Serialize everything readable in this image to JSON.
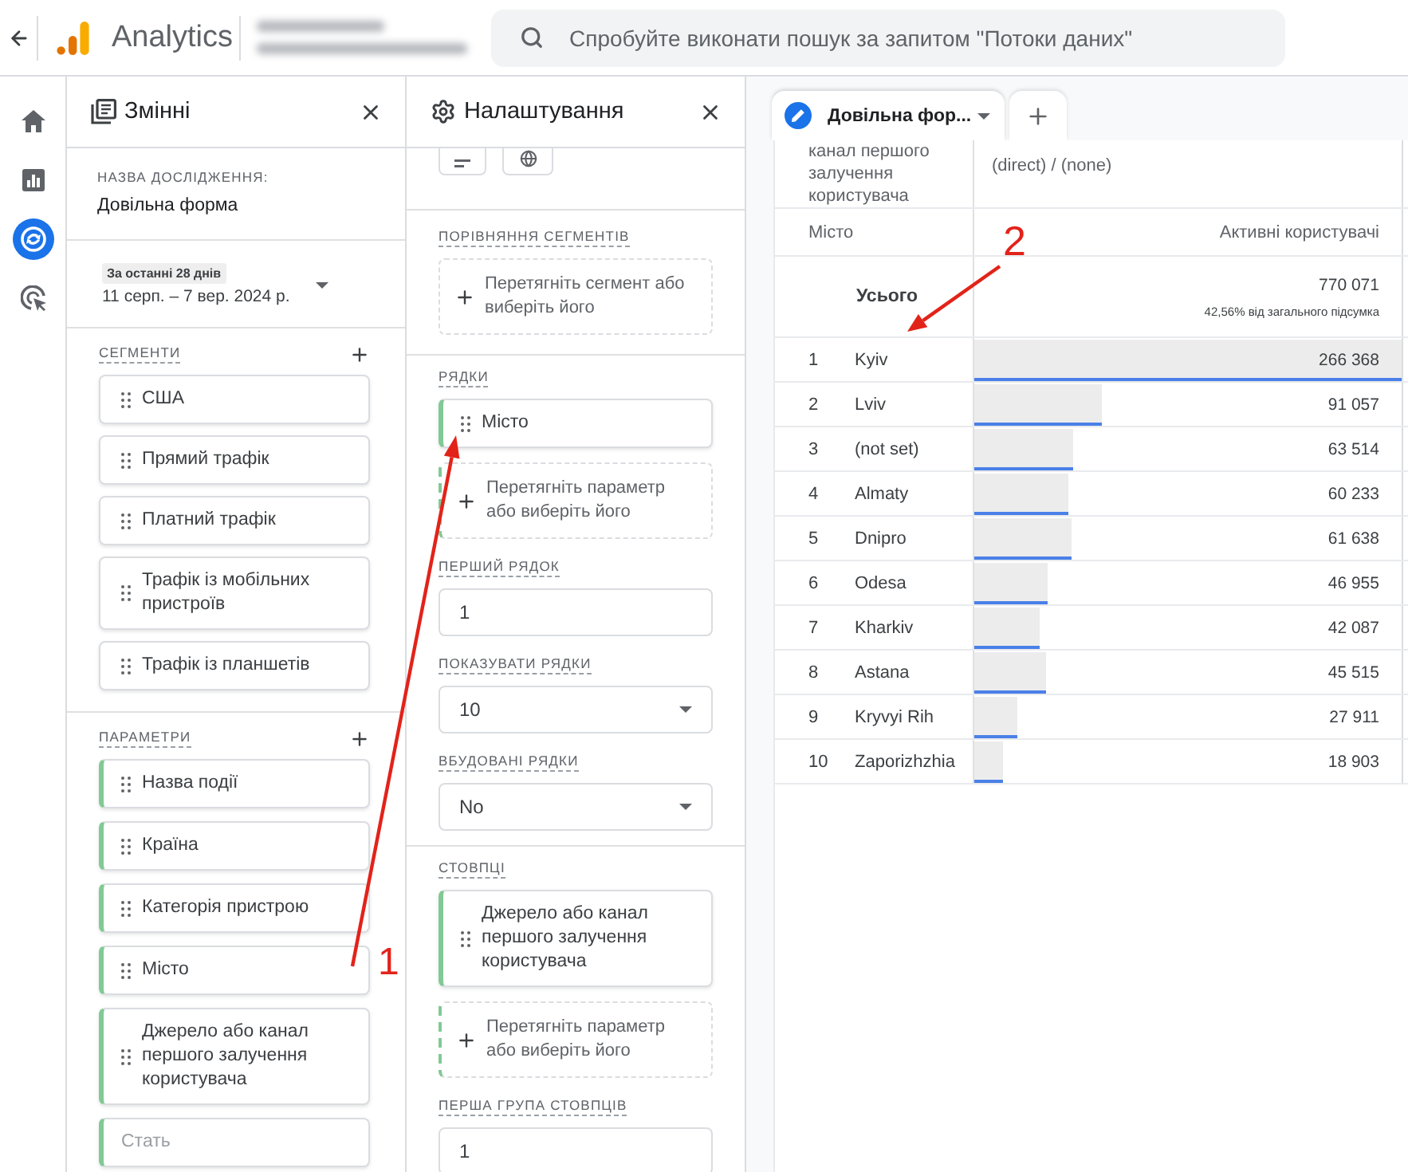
{
  "top_bar": {
    "product_name": "Analytics",
    "search": {
      "placeholder": "Спробуйте виконати пошук за запитом \"Потоки даних\""
    }
  },
  "nav_rail": {
    "items": [
      {
        "selected": false
      },
      {
        "selected": false
      },
      {
        "selected": true
      },
      {
        "selected": false
      }
    ]
  },
  "variables_panel": {
    "title": "Змінні",
    "exploration_name": {
      "label": "НАЗВА ДОСЛІДЖЕННЯ:",
      "value": "Довільна форма"
    },
    "date_range": {
      "preset": "За останні 28 днів",
      "range": "11 серп. – 7 вер. 2024 р."
    },
    "segments": {
      "label": "СЕГМЕНТИ",
      "items": [
        "США",
        "Прямий трафік",
        "Платний трафік",
        "Трафік із мобільних пристроїв",
        "Трафік із планшетів"
      ]
    },
    "dimensions": {
      "label": "ПАРАМЕТРИ",
      "items": [
        {
          "name": "Назва події",
          "disabled": false
        },
        {
          "name": "Країна",
          "disabled": false
        },
        {
          "name": "Категорія пристрою",
          "disabled": false
        },
        {
          "name": "Місто",
          "disabled": false
        },
        {
          "name": "Джерело або канал першого залучення користувача",
          "disabled": false
        },
        {
          "name": "Стать",
          "disabled": true
        }
      ]
    }
  },
  "settings_panel": {
    "title": "Налаштування",
    "segment_comparison": {
      "label": "ПОРІВНЯННЯ СЕГМЕНТІВ",
      "drop_hint": "Перетягніть сегмент або виберіть його"
    },
    "rows": {
      "label": "РЯДКИ",
      "items": [
        "Місто"
      ],
      "drop_hint": "Перетягніть параметр або виберіть його"
    },
    "first_row": {
      "label": "ПЕРШИЙ РЯДОК",
      "value": "1"
    },
    "show_rows": {
      "label": "ПОКАЗУВАТИ РЯДКИ",
      "value": "10"
    },
    "nested_rows": {
      "label": "ВБУДОВАНІ РЯДКИ",
      "value": "No"
    },
    "columns": {
      "label": "СТОВПЦІ",
      "items": [
        "Джерело або канал першого залучення користувача"
      ],
      "drop_hint": "Перетягніть параметр або виберіть його"
    },
    "first_column_group": {
      "label": "ПЕРША ГРУПА СТОВПЦІВ",
      "value": "1"
    }
  },
  "report": {
    "tabs": [
      {
        "label": "Довільна фор...",
        "selected": true
      }
    ],
    "table": {
      "column_dimension": "канал першого залучення користувача",
      "column_value": "(direct) / (none)",
      "row_dimension": "Місто",
      "metric": "Активні користувачі",
      "total": {
        "label": "Усього",
        "value": "770 071",
        "share": "42,56% від загального підсумка"
      },
      "rows": [
        {
          "rank": "1",
          "city": "Kyiv",
          "value": "266 368",
          "level": 1
        },
        {
          "rank": "2",
          "city": "Lviv",
          "value": "91 057",
          "level": 0.3
        },
        {
          "rank": "3",
          "city": "(not set)",
          "value": "63 514",
          "level": 0.23
        },
        {
          "rank": "4",
          "city": "Almaty",
          "value": "60 233",
          "level": 0.22
        },
        {
          "rank": "5",
          "city": "Dnipro",
          "value": "61 638",
          "level": 0.226
        },
        {
          "rank": "6",
          "city": "Odesa",
          "value": "46 955",
          "level": 0.17
        },
        {
          "rank": "7",
          "city": "Kharkiv",
          "value": "42 087",
          "level": 0.153
        },
        {
          "rank": "8",
          "city": "Astana",
          "value": "45 515",
          "level": 0.167
        },
        {
          "rank": "9",
          "city": "Kryvyi Rih",
          "value": "27 911",
          "level": 0.1
        },
        {
          "rank": "10",
          "city": "Zaporizhzhia",
          "value": "18 903",
          "level": 0.066
        }
      ]
    }
  },
  "annotations": [
    {
      "label": "1"
    },
    {
      "label": "2"
    }
  ]
}
